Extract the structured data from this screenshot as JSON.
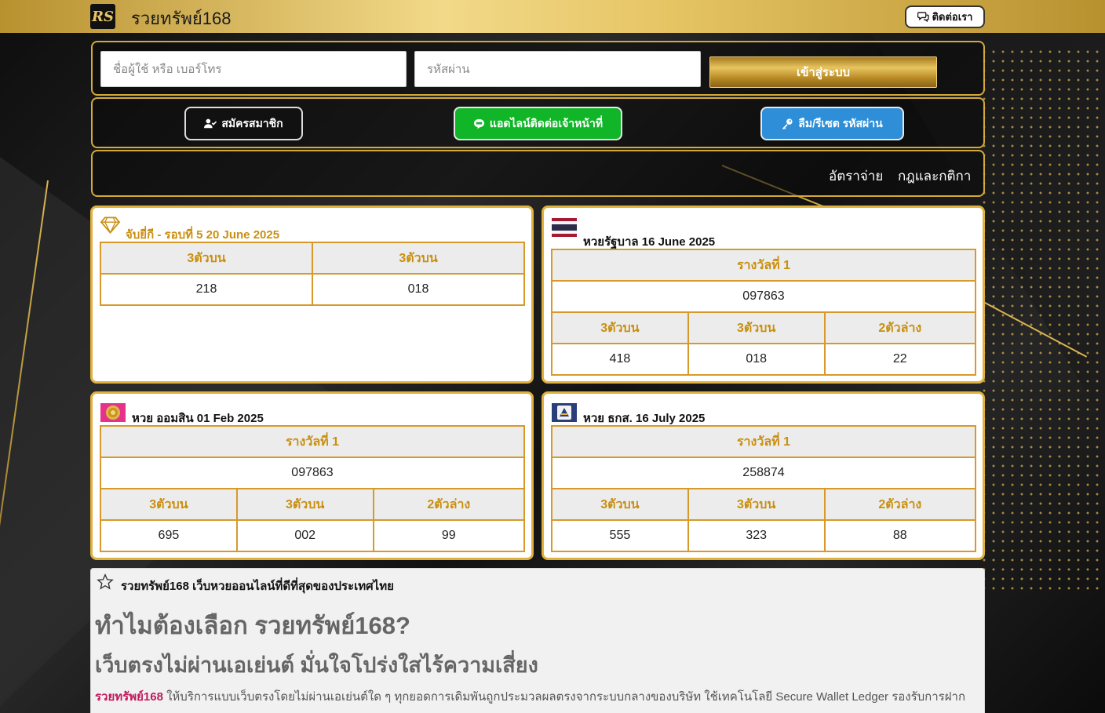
{
  "header": {
    "logo_text": "RS",
    "site_title": "รวยทรัพย์168",
    "contact_label": "ติดต่อเรา"
  },
  "login": {
    "username_placeholder": "ชื่อผู้ใช้ หรือ เบอร์โทร",
    "password_placeholder": "รหัสผ่าน",
    "login_label": "เข้าสู่ระบบ"
  },
  "actions": {
    "register_label": "สมัครสมาชิก",
    "line_label": "แอดไลน์ติดต่อเจ้าหน้าที่",
    "reset_label": "ลืม/รีเซต รหัสผ่าน"
  },
  "menu": {
    "rates_label": "อัตราจ่าย",
    "rules_label": "กฎและกติกา"
  },
  "cards": {
    "yeekee": {
      "title": "จับยี่กี - รอบที่ 5 20 June 2025",
      "headers": [
        "3ตัวบน",
        "3ตัวบน"
      ],
      "values": [
        "218",
        "018"
      ]
    },
    "government": {
      "title": "หวยรัฐบาล 16 June 2025",
      "prize_label": "รางวัลที่ 1",
      "prize_value": "097863",
      "headers": [
        "3ตัวบน",
        "3ตัวบน",
        "2ตัวล่าง"
      ],
      "values": [
        "418",
        "018",
        "22"
      ]
    },
    "gsb": {
      "title": "หวย ออมสิน 01 Feb 2025",
      "prize_label": "รางวัลที่ 1",
      "prize_value": "097863",
      "headers": [
        "3ตัวบน",
        "3ตัวบน",
        "2ตัวล่าง"
      ],
      "values": [
        "695",
        "002",
        "99"
      ]
    },
    "baac": {
      "title": "หวย ธกส. 16 July 2025",
      "prize_label": "รางวัลที่ 1",
      "prize_value": "258874",
      "headers": [
        "3ตัวบน",
        "3ตัวบน",
        "2ตัวล่าง"
      ],
      "values": [
        "555",
        "323",
        "88"
      ]
    }
  },
  "info": {
    "heading": "รวยทรัพย์168 เว็บหวยออนไลน์ที่ดีที่สุดของประเทศไทย",
    "h2": "ทำไมต้องเลือก รวยทรัพย์168?",
    "h3": "เว็บตรงไม่ผ่านเอเย่นต์ มั่นใจโปร่งใสไร้ความเสี่ยง",
    "brand": "รวยทรัพย์168",
    "paragraph": " ให้บริการแบบเว็บตรงโดยไม่ผ่านเอเย่นต์ใด ๆ ทุกยอดการเดิมพันถูกประมวลผลตรงจากระบบกลางของบริษัท ใช้เทคโนโลยี Secure Wallet Ledger รองรับการฝาก"
  },
  "colors": {
    "gold": "#e0b13c",
    "gold_text": "#c98f10",
    "line_green": "#11b628",
    "reset_blue": "#2e8fd8",
    "brand_pink": "#c2185b"
  },
  "icons": {
    "contact": "chat-bubbles-icon",
    "register": "user-check-icon",
    "line": "line-chat-icon",
    "reset": "key-icon",
    "yeekee": "diamond-icon",
    "government": "thai-flag-icon",
    "gsb": "gsb-logo-icon",
    "baac": "baac-logo-icon",
    "info": "star-outline-icon"
  }
}
